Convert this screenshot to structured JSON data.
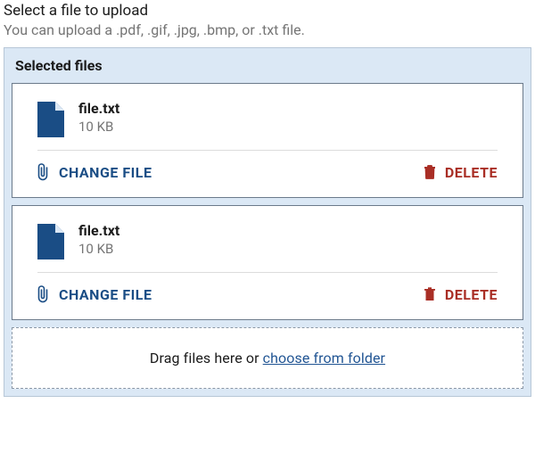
{
  "title": "Select a file to upload",
  "hint": "You can upload a .pdf, .gif, .jpg, .bmp, or .txt file.",
  "panel_heading": "Selected files",
  "change_label": "CHANGE FILE",
  "delete_label": "DELETE",
  "dropzone": {
    "text_before": "Drag files here or ",
    "link": "choose from folder"
  },
  "files": [
    {
      "name": "file.txt",
      "size": "10 KB"
    },
    {
      "name": "file.txt",
      "size": "10 KB"
    }
  ],
  "colors": {
    "file_icon": "#1a4d85",
    "change": "#1a4d85",
    "delete": "#a92e25",
    "panel_bg": "#dbe8f5"
  }
}
